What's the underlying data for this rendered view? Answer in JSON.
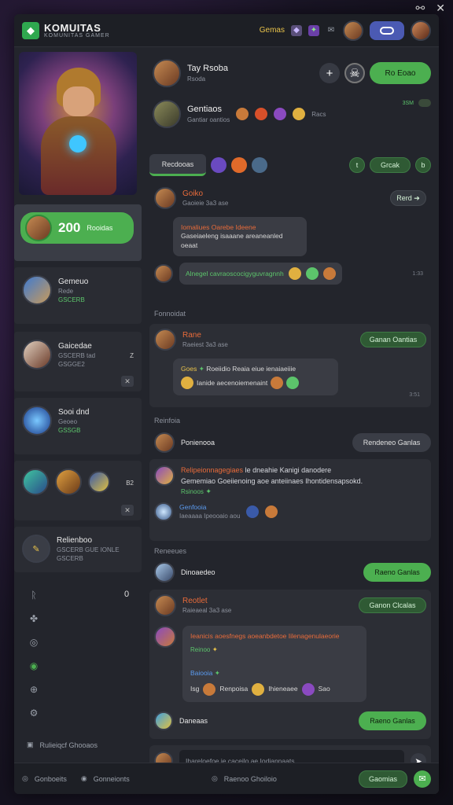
{
  "system": {
    "icons": [
      "link-icon",
      "close-icon"
    ],
    "link_glyph": "⚯",
    "close_glyph": "✕"
  },
  "app": {
    "name": "KOMUITAS",
    "subtitle": "KOMUNITAS GAMER",
    "top_label": "Gemas",
    "accent": "#4caf50"
  },
  "sidebar": {
    "stat": {
      "value": "200",
      "label": "Rooidas"
    },
    "items": [
      {
        "title": "Gemeuo",
        "line1": "Rede",
        "line2": "GSCERB"
      },
      {
        "title": "Gaicedae",
        "line1": "GSCERB tad",
        "line2": "GSGGE2",
        "badge": "Z"
      },
      {
        "title": "Sooi dnd",
        "line1": "Geoeo",
        "line2": "GSSGB"
      },
      {
        "title": "",
        "line1": "",
        "line2": "",
        "badge": "B2"
      },
      {
        "title": "Relienboo",
        "line1": "GSCERB GUE IONLE",
        "line2": "GSCERB"
      }
    ],
    "footer_label": "Rulieiqcf Ghooaos",
    "close_glyph": "✕",
    "counter": "0"
  },
  "profile": {
    "name": "Tay Rsoba",
    "sub": "Rsoda",
    "follow_label": "Ro Eoao",
    "plus": "+"
  },
  "community": {
    "name": "Gentiaos",
    "sub": "Gantiar oantios",
    "extra": "Racs",
    "online": "3SM"
  },
  "tabs": {
    "active": "Recdooas",
    "btn_small": "t",
    "btn_main": "Grcak",
    "btn_icon": "b"
  },
  "posts": [
    {
      "user": "Goiko",
      "meta": "Gaoieie 3a3 ase",
      "action": "Rerd ➔",
      "bubble_title": "Iomaliues Oarebe Ideene",
      "bubble_body": "Gaseiaeleng isaaane areaneanled oeaat",
      "reply_text": "Alnegel cavraoscocigyguvragnnh",
      "time": "1:33"
    },
    {
      "section": "Fonnoidat",
      "user": "Rane",
      "meta": "Raeiest 3a3 ase",
      "action": "Ganan Oantias",
      "line1": "Roeiidio Reaia eiue ienaiaeiiie",
      "line1_lead": "Goes",
      "line2": "Ianide aecenoiemenaint",
      "time": "3:51"
    },
    {
      "section": "Reinfoia",
      "user": "Ponienooa",
      "action": "Rendeneo Ganlas",
      "title": "Relipeionnagegiaes",
      "title_tail": "le dneahie Kanigi danodere",
      "body": "Gememiao Goeiienoing aoe anteiinaes Ihontidensapsokd.",
      "tag": "Rsinoos",
      "sub_user": "Genfooia",
      "sub_text": "Iaeaaaa Ipeooaio aou"
    },
    {
      "section": "Reneeues",
      "user": "Dinoaedeo",
      "action": "Raeno Ganlas"
    },
    {
      "user": "Reotlet",
      "meta": "Raieaeal 3a3 ase",
      "action": "Ganon Clcalas",
      "bubble_title": "Ieanicis aoesfnegs aoeanbdetoe Iilenagenulaeorie",
      "bubble_tag": "Reinoo",
      "line_user": "Baiooia",
      "line_a": "Isg",
      "line_b": "Renpoisa",
      "line_c": "Ihieneaee",
      "line_d": "Sao"
    },
    {
      "user": "Daneaas",
      "action": "Raeno Ganlas"
    }
  ],
  "composer": {
    "placeholder": "Ihareloefoe ie caceilo ae Iodiannaats"
  },
  "status": {
    "left1": "Gonboeits",
    "left2": "Gonneionts",
    "center": "Raenoo Ghoiloio",
    "button": "Gaomias"
  }
}
